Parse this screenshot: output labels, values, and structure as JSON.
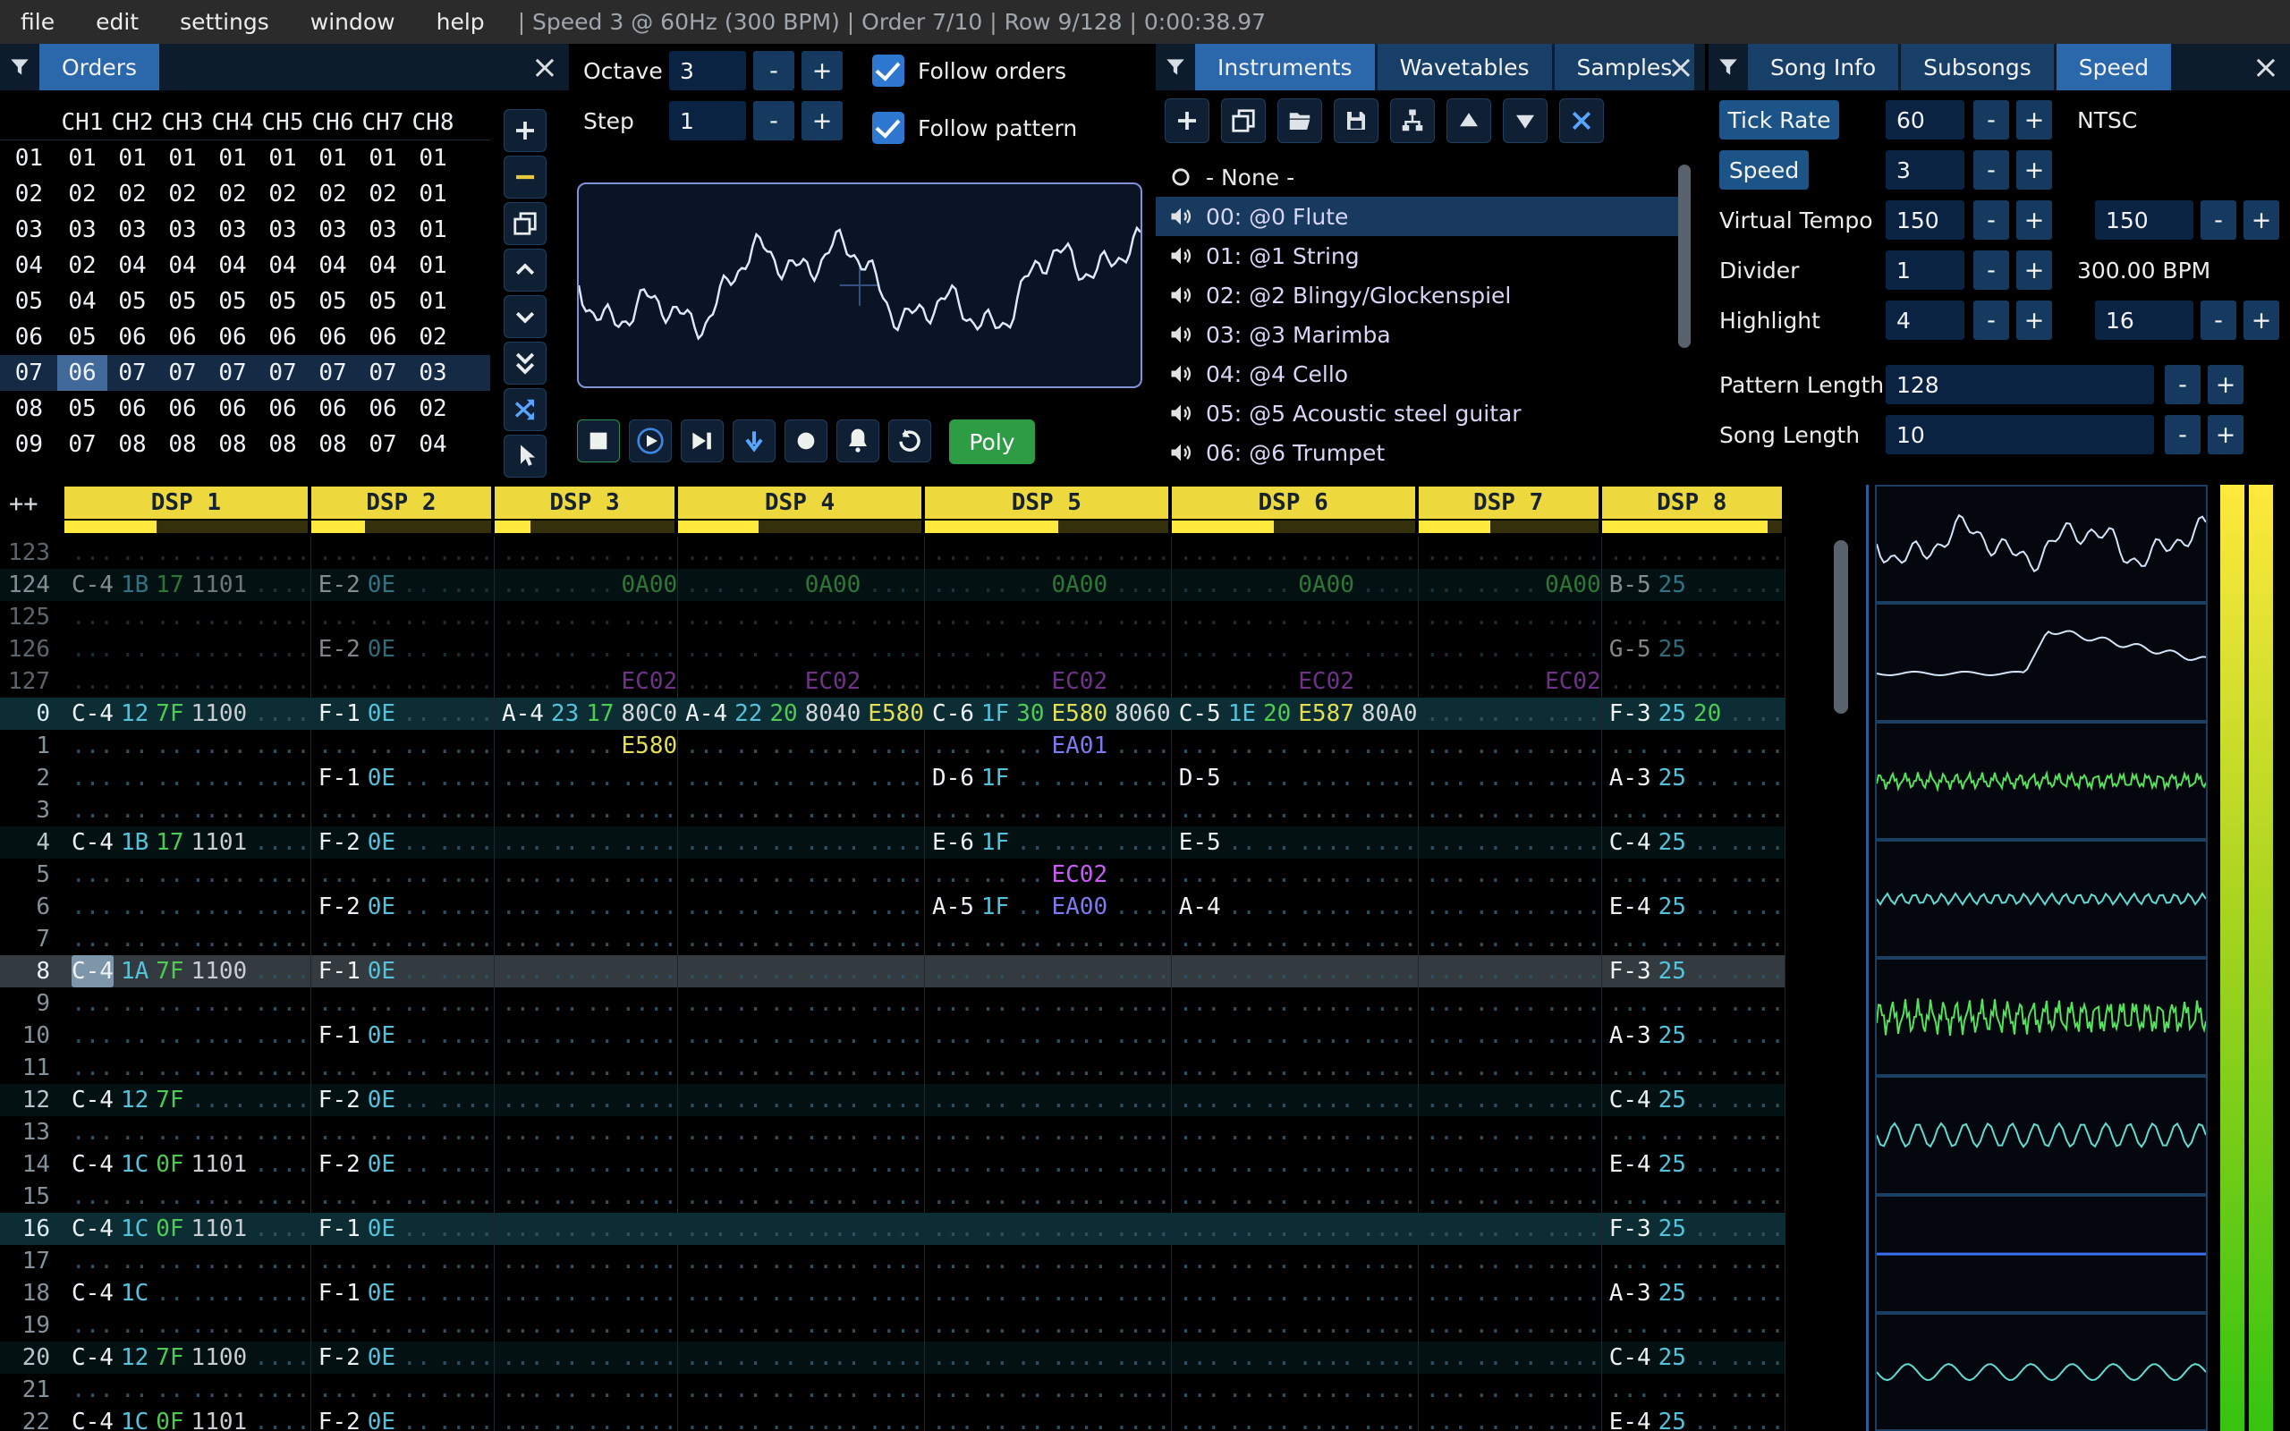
{
  "ui": {
    "minus": "-",
    "plus": "+",
    "close": "×"
  },
  "menubar": {
    "items": [
      "file",
      "edit",
      "settings",
      "window",
      "help"
    ],
    "status": "| Speed 3 @ 60Hz (300 BPM) | Order 7/10 | Row 9/128 | 0:00:38.97"
  },
  "orders": {
    "title": "Orders",
    "columns": [
      "CH1",
      "CH2",
      "CH3",
      "CH4",
      "CH5",
      "CH6",
      "CH7",
      "CH8"
    ],
    "rows": [
      {
        "num": "01",
        "vals": [
          "01",
          "01",
          "01",
          "01",
          "01",
          "01",
          "01",
          "01"
        ]
      },
      {
        "num": "02",
        "vals": [
          "02",
          "02",
          "02",
          "02",
          "02",
          "02",
          "02",
          "01"
        ]
      },
      {
        "num": "03",
        "vals": [
          "03",
          "03",
          "03",
          "03",
          "03",
          "03",
          "03",
          "01"
        ]
      },
      {
        "num": "04",
        "vals": [
          "02",
          "04",
          "04",
          "04",
          "04",
          "04",
          "04",
          "01"
        ]
      },
      {
        "num": "05",
        "vals": [
          "04",
          "05",
          "05",
          "05",
          "05",
          "05",
          "05",
          "01"
        ]
      },
      {
        "num": "06",
        "vals": [
          "05",
          "06",
          "06",
          "06",
          "06",
          "06",
          "06",
          "02"
        ]
      },
      {
        "num": "07",
        "vals": [
          "06",
          "07",
          "07",
          "07",
          "07",
          "07",
          "07",
          "03"
        ]
      },
      {
        "num": "08",
        "vals": [
          "05",
          "06",
          "06",
          "06",
          "06",
          "06",
          "06",
          "02"
        ]
      },
      {
        "num": "09",
        "vals": [
          "07",
          "08",
          "08",
          "08",
          "08",
          "08",
          "07",
          "04"
        ]
      }
    ],
    "selected_row": 6,
    "cursor_col": 0,
    "toolbar": [
      "add",
      "remove",
      "duplicate",
      "move-up",
      "move-down",
      "move-bottom",
      "change-order",
      "pointer"
    ]
  },
  "playback": {
    "octave_label": "Octave",
    "octave_value": "3",
    "step_label": "Step",
    "step_value": "1",
    "follow_orders_label": "Follow orders",
    "follow_pattern_label": "Follow pattern",
    "transport": [
      "stop",
      "play",
      "play-pattern",
      "step-row",
      "record",
      "metronome",
      "repeat"
    ],
    "poly_label": "Poly"
  },
  "instruments": {
    "tabs": [
      "Instruments",
      "Wavetables",
      "Samples"
    ],
    "active_tab": 0,
    "toolbar": [
      "add",
      "duplicate",
      "open",
      "save",
      "folders",
      "up",
      "down",
      "delete"
    ],
    "items": [
      {
        "icon": "none",
        "label": "- None -"
      },
      {
        "icon": "speaker",
        "label": "00: @0 Flute",
        "selected": true
      },
      {
        "icon": "speaker",
        "label": "01: @1 String"
      },
      {
        "icon": "speaker",
        "label": "02: @2 Blingy/Glockenspiel"
      },
      {
        "icon": "speaker",
        "label": "03: @3 Marimba"
      },
      {
        "icon": "speaker",
        "label": "04: @4 Cello"
      },
      {
        "icon": "speaker",
        "label": "05: @5 Acoustic steel guitar"
      },
      {
        "icon": "speaker",
        "label": "06: @6 Trumpet"
      }
    ]
  },
  "song": {
    "tabs": [
      "Song Info",
      "Subsongs",
      "Speed"
    ],
    "active_tab": 2,
    "fields": {
      "tick_rate_label": "Tick Rate",
      "tick_rate": "60",
      "tick_rate_mode": "NTSC",
      "speed_label": "Speed",
      "speed": "3",
      "virtual_tempo_label": "Virtual Tempo",
      "virtual_tempo_num": "150",
      "virtual_tempo_den": "150",
      "divider_label": "Divider",
      "divider": "1",
      "bpm_readout": "300.00 BPM",
      "highlight_label": "Highlight",
      "highlight_first": "4",
      "highlight_second": "16",
      "pattern_length_label": "Pattern Length",
      "pattern_length": "128",
      "song_length_label": "Song Length",
      "song_length": "10"
    }
  },
  "pattern": {
    "corner": "++",
    "channels": [
      {
        "name": "DSP 1",
        "fx": 2,
        "vu": 0.38
      },
      {
        "name": "DSP 2",
        "fx": 1,
        "vu": 0.3
      },
      {
        "name": "DSP 3",
        "fx": 1,
        "vu": 0.2
      },
      {
        "name": "DSP 4",
        "fx": 2,
        "vu": 0.33
      },
      {
        "name": "DSP 5",
        "fx": 2,
        "vu": 0.55
      },
      {
        "name": "DSP 6",
        "fx": 2,
        "vu": 0.42
      },
      {
        "name": "DSP 7",
        "fx": 1,
        "vu": 0.4
      },
      {
        "name": "DSP 8",
        "fx": 1,
        "vu": 0.92
      }
    ],
    "prev_row_count": 5,
    "cursor_row": "8",
    "cursor_channel": 0,
    "rows": [
      {
        "num": "123",
        "cells": [
          null,
          null,
          null,
          null,
          null,
          null,
          null,
          null
        ]
      },
      {
        "num": "124",
        "cells": [
          {
            "note": "C-4",
            "ins": "1B",
            "vol": "17",
            "fx": [
              [
                "1101",
                "gray"
              ]
            ]
          },
          {
            "note": "E-2",
            "ins": "0E"
          },
          {
            "fx": [
              [
                "0A00",
                "green"
              ]
            ]
          },
          {
            "fx": [
              [
                "0A00",
                "green"
              ]
            ]
          },
          {
            "fx": [
              [
                "0A00",
                "green"
              ]
            ]
          },
          {
            "fx": [
              [
                "0A00",
                "green"
              ]
            ]
          },
          {
            "fx": [
              [
                "0A00",
                "green"
              ]
            ]
          },
          {
            "note": "B-5",
            "ins": "25"
          }
        ]
      },
      {
        "num": "125",
        "cells": [
          null,
          null,
          null,
          null,
          null,
          null,
          null,
          null
        ]
      },
      {
        "num": "126",
        "cells": [
          null,
          {
            "note": "E-2",
            "ins": "0E"
          },
          null,
          null,
          null,
          null,
          null,
          {
            "note": "G-5",
            "ins": "25"
          }
        ]
      },
      {
        "num": "127",
        "cells": [
          null,
          null,
          {
            "fx": [
              [
                "EC02",
                "purple"
              ]
            ]
          },
          {
            "fx": [
              [
                "EC02",
                "purple"
              ]
            ]
          },
          {
            "fx": [
              [
                "EC02",
                "purple"
              ]
            ]
          },
          {
            "fx": [
              [
                "EC02",
                "purple"
              ]
            ]
          },
          {
            "fx": [
              [
                "EC02",
                "purple"
              ]
            ]
          },
          null
        ]
      },
      {
        "num": "0",
        "cells": [
          {
            "note": "C-4",
            "ins": "12",
            "vol": "7F",
            "fx": [
              [
                "1100",
                "gray"
              ]
            ]
          },
          {
            "note": "F-1",
            "ins": "0E"
          },
          {
            "note": "A-4",
            "ins": "23",
            "vol": "17",
            "fx": [
              [
                "80C0",
                "pan"
              ]
            ]
          },
          {
            "note": "A-4",
            "ins": "22",
            "vol": "20",
            "fx": [
              [
                "8040",
                "pan"
              ],
              [
                "E580",
                "yellow"
              ]
            ]
          },
          {
            "note": "C-6",
            "ins": "1F",
            "vol": "30",
            "fx": [
              [
                "E580",
                "yellow"
              ],
              [
                "8060",
                "pan"
              ]
            ]
          },
          {
            "note": "C-5",
            "ins": "1E",
            "vol": "20",
            "fx": [
              [
                "E587",
                "yellow"
              ],
              [
                "80A0",
                "pan"
              ]
            ]
          },
          null,
          {
            "note": "F-3",
            "ins": "25",
            "vol": "20"
          }
        ]
      },
      {
        "num": "1",
        "cells": [
          null,
          null,
          {
            "fx": [
              [
                "E580",
                "yellow"
              ]
            ]
          },
          null,
          {
            "fx": [
              [
                "EA01",
                "indigo"
              ]
            ]
          },
          null,
          null,
          null
        ]
      },
      {
        "num": "2",
        "cells": [
          null,
          {
            "note": "F-1",
            "ins": "0E"
          },
          null,
          null,
          {
            "note": "D-6",
            "ins": "1F"
          },
          {
            "note": "D-5"
          },
          null,
          {
            "note": "A-3",
            "ins": "25"
          }
        ]
      },
      {
        "num": "3",
        "cells": [
          null,
          null,
          null,
          null,
          null,
          null,
          null,
          null
        ]
      },
      {
        "num": "4",
        "cells": [
          {
            "note": "C-4",
            "ins": "1B",
            "vol": "17",
            "fx": [
              [
                "1101",
                "gray"
              ]
            ]
          },
          {
            "note": "F-2",
            "ins": "0E"
          },
          null,
          null,
          {
            "note": "E-6",
            "ins": "1F"
          },
          {
            "note": "E-5"
          },
          null,
          {
            "note": "C-4",
            "ins": "25"
          }
        ]
      },
      {
        "num": "5",
        "cells": [
          null,
          null,
          null,
          null,
          {
            "fx": [
              [
                "EC02",
                "purple"
              ]
            ]
          },
          null,
          null,
          null
        ]
      },
      {
        "num": "6",
        "cells": [
          null,
          {
            "note": "F-2",
            "ins": "0E"
          },
          null,
          null,
          {
            "note": "A-5",
            "ins": "1F",
            "fx": [
              [
                "EA00",
                "indigo"
              ]
            ]
          },
          {
            "note": "A-4"
          },
          null,
          {
            "note": "E-4",
            "ins": "25"
          }
        ]
      },
      {
        "num": "7",
        "cells": [
          null,
          null,
          null,
          null,
          null,
          null,
          null,
          null
        ]
      },
      {
        "num": "8",
        "cells": [
          {
            "note": "C-4",
            "ins": "1A",
            "vol": "7F",
            "fx": [
              [
                "1100",
                "gray"
              ]
            ]
          },
          {
            "note": "F-1",
            "ins": "0E"
          },
          null,
          null,
          null,
          null,
          null,
          {
            "note": "F-3",
            "ins": "25"
          }
        ]
      },
      {
        "num": "9",
        "cells": [
          null,
          null,
          null,
          null,
          null,
          null,
          null,
          null
        ]
      },
      {
        "num": "10",
        "cells": [
          null,
          {
            "note": "F-1",
            "ins": "0E"
          },
          null,
          null,
          null,
          null,
          null,
          {
            "note": "A-3",
            "ins": "25"
          }
        ]
      },
      {
        "num": "11",
        "cells": [
          null,
          null,
          null,
          null,
          null,
          null,
          null,
          null
        ]
      },
      {
        "num": "12",
        "cells": [
          {
            "note": "C-4",
            "ins": "12",
            "vol": "7F"
          },
          {
            "note": "F-2",
            "ins": "0E"
          },
          null,
          null,
          null,
          null,
          null,
          {
            "note": "C-4",
            "ins": "25"
          }
        ]
      },
      {
        "num": "13",
        "cells": [
          null,
          null,
          null,
          null,
          null,
          null,
          null,
          null
        ]
      },
      {
        "num": "14",
        "cells": [
          {
            "note": "C-4",
            "ins": "1C",
            "vol": "0F",
            "fx": [
              [
                "1101",
                "gray"
              ]
            ]
          },
          {
            "note": "F-2",
            "ins": "0E"
          },
          null,
          null,
          null,
          null,
          null,
          {
            "note": "E-4",
            "ins": "25"
          }
        ]
      },
      {
        "num": "15",
        "cells": [
          null,
          null,
          null,
          null,
          null,
          null,
          null,
          null
        ]
      },
      {
        "num": "16",
        "cells": [
          {
            "note": "C-4",
            "ins": "1C",
            "vol": "0F",
            "fx": [
              [
                "1101",
                "gray"
              ]
            ]
          },
          {
            "note": "F-1",
            "ins": "0E"
          },
          null,
          null,
          null,
          null,
          null,
          {
            "note": "F-3",
            "ins": "25"
          }
        ]
      },
      {
        "num": "17",
        "cells": [
          null,
          null,
          null,
          null,
          null,
          null,
          null,
          null
        ]
      },
      {
        "num": "18",
        "cells": [
          {
            "note": "C-4",
            "ins": "1C"
          },
          {
            "note": "F-1",
            "ins": "0E"
          },
          null,
          null,
          null,
          null,
          null,
          {
            "note": "A-3",
            "ins": "25"
          }
        ]
      },
      {
        "num": "19",
        "cells": [
          null,
          null,
          null,
          null,
          null,
          null,
          null,
          null
        ]
      },
      {
        "num": "20",
        "cells": [
          {
            "note": "C-4",
            "ins": "12",
            "vol": "7F",
            "fx": [
              [
                "1100",
                "gray"
              ]
            ]
          },
          {
            "note": "F-2",
            "ins": "0E"
          },
          null,
          null,
          null,
          null,
          null,
          {
            "note": "C-4",
            "ins": "25"
          }
        ]
      },
      {
        "num": "21",
        "cells": [
          null,
          null,
          null,
          null,
          null,
          null,
          null,
          null
        ]
      },
      {
        "num": "22",
        "cells": [
          {
            "note": "C-4",
            "ins": "1C",
            "vol": "0F",
            "fx": [
              [
                "1101",
                "gray"
              ]
            ]
          },
          {
            "note": "F-2",
            "ins": "0E"
          },
          null,
          null,
          null,
          null,
          null,
          {
            "note": "E-4",
            "ins": "25"
          }
        ]
      }
    ]
  },
  "scopes": [
    {
      "style": "noise",
      "color": "#d4e4f8",
      "amp": 16,
      "freq": 0
    },
    {
      "style": "env",
      "color": "#d4e4f8",
      "amp": 0,
      "freq": 0
    },
    {
      "style": "fuzz",
      "color": "#57e05c",
      "amp": 6,
      "freq": 0
    },
    {
      "style": "sine",
      "color": "#62dcd2",
      "amp": 6,
      "freq": 24
    },
    {
      "style": "fuzz",
      "color": "#57e05c",
      "amp": 13,
      "freq": 0
    },
    {
      "style": "sine",
      "color": "#62dcd2",
      "amp": 13,
      "freq": 14
    },
    {
      "style": "flat",
      "color": "#3c6cf2",
      "amp": 0,
      "freq": 0
    },
    {
      "style": "sine",
      "color": "#62dcd2",
      "amp": 9,
      "freq": 8
    }
  ],
  "meters": {
    "top_color": "#ffe93c",
    "mid_color": "#a8d41f",
    "bottom_color": "#35c410"
  }
}
